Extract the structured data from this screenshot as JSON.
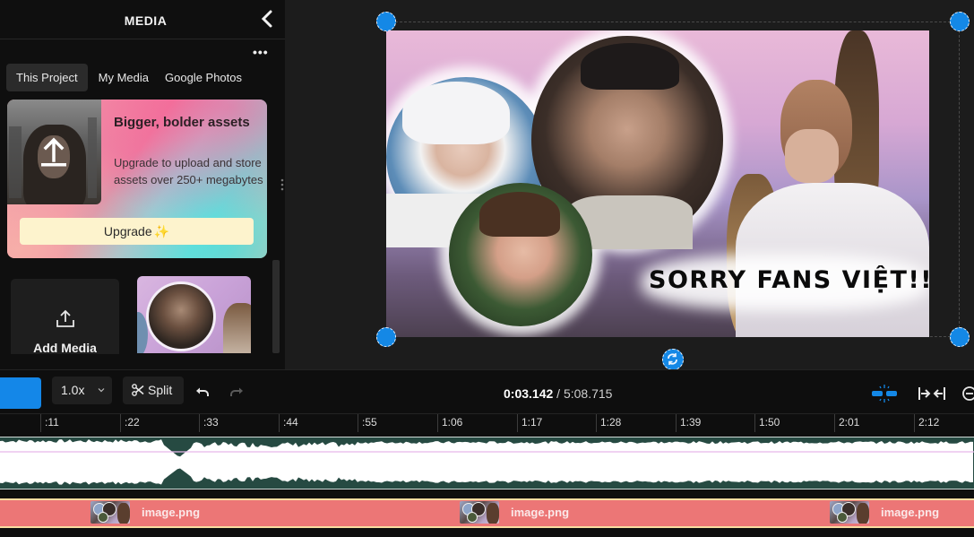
{
  "sidebar": {
    "title": "MEDIA",
    "tabs": [
      {
        "label": "This Project",
        "active": true
      },
      {
        "label": "My Media",
        "active": false
      },
      {
        "label": "Google Photos",
        "active": false
      }
    ],
    "more_label": "•••",
    "promo": {
      "title": "Bigger, bolder assets",
      "description": "Upgrade to upload and store assets over 250+ megabytes",
      "button_label": "Upgrade",
      "button_sparkle": "✨"
    },
    "add_media_label": "Add Media"
  },
  "canvas": {
    "caption_text": "SORRY FANS VIỆT!!"
  },
  "toolbar": {
    "speed_value": "1.0x",
    "split_label": "Split",
    "current_time": "0:03.142",
    "separator": " / ",
    "total_time": "5:08.715"
  },
  "ruler": {
    "ticks": [
      ":11",
      ":22",
      ":33",
      ":44",
      ":55",
      "1:06",
      "1:17",
      "1:28",
      "1:39",
      "1:50",
      "2:01",
      "2:12"
    ]
  },
  "tracks": {
    "image_clips": [
      {
        "label": "image.png"
      },
      {
        "label": "image.png"
      },
      {
        "label": "image.png"
      }
    ]
  },
  "colors": {
    "accent": "#1488e6",
    "audio_track": "#264a42",
    "image_track": "#ec7676",
    "track_border": "#f7dca0"
  }
}
